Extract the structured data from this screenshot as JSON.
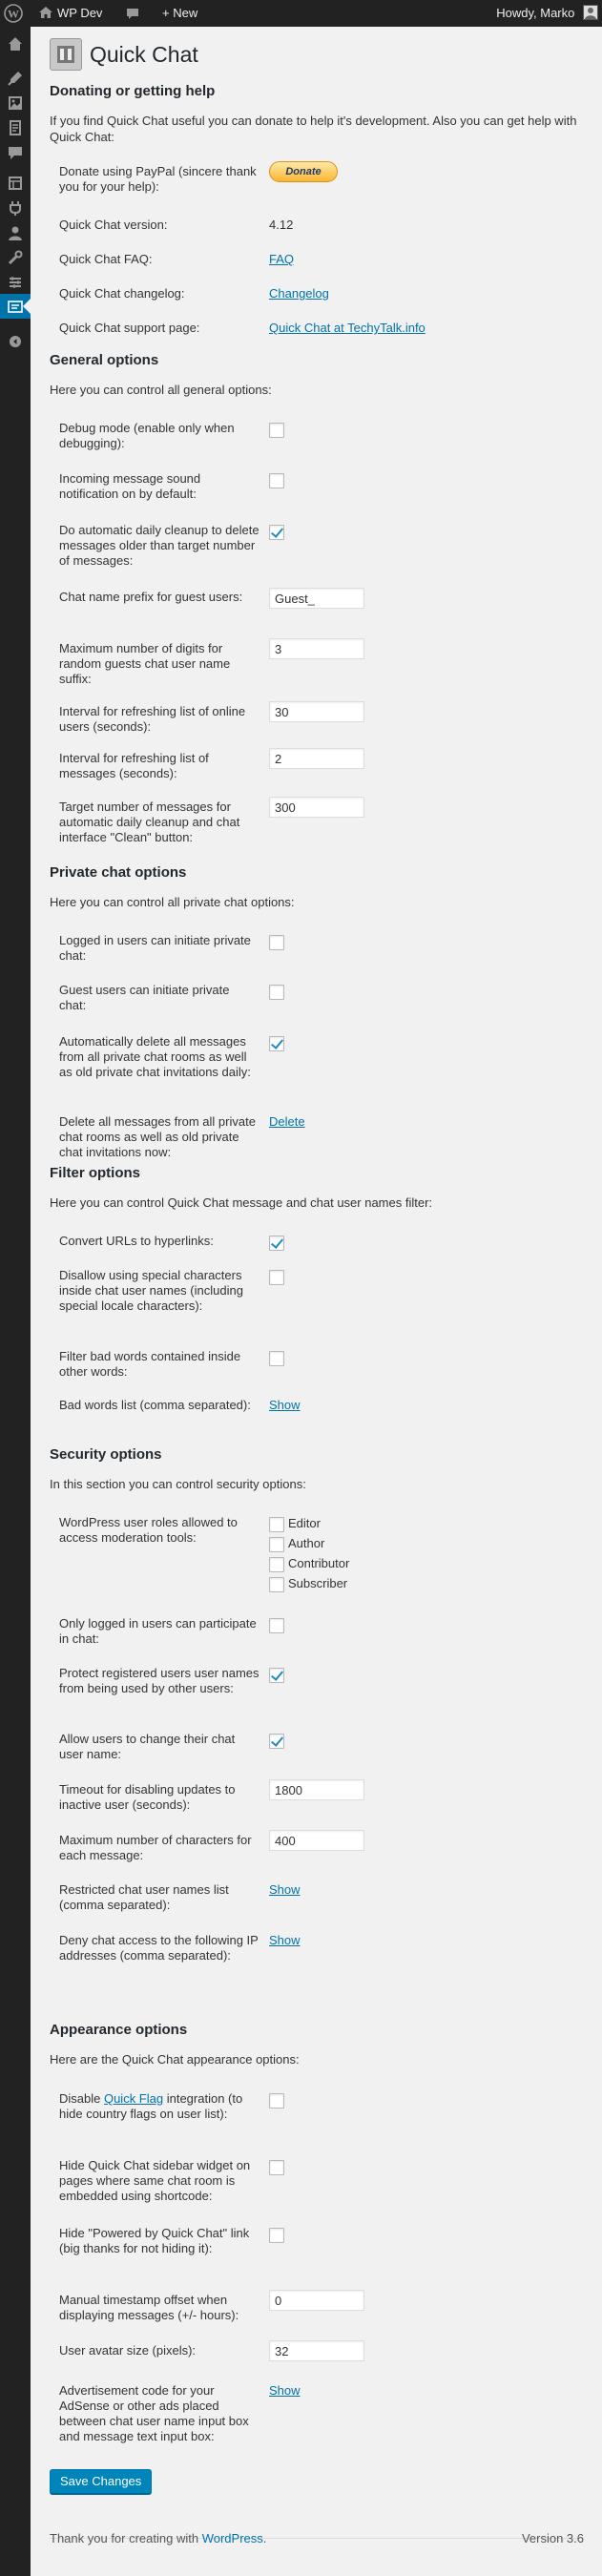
{
  "adminbar": {
    "site_name": "WP Dev",
    "new_label": "+ New",
    "howdy": "Howdy, Marko"
  },
  "page": {
    "title": "Quick Chat"
  },
  "donate": {
    "heading": "Donating or getting help",
    "desc": "If you find Quick Chat useful you can donate to help it's development. Also you can get help with Quick Chat:",
    "paypal_label": "Donate using PayPal (sincere thank you for your help):",
    "paypal_button": "Donate",
    "version_label": "Quick Chat version:",
    "version_value": "4.12",
    "faq_label": "Quick Chat FAQ:",
    "faq_link": "FAQ",
    "changelog_label": "Quick Chat changelog:",
    "changelog_link": "Changelog",
    "support_label": "Quick Chat support page:",
    "support_link": "Quick Chat at TechyTalk.info"
  },
  "general": {
    "heading": "General options",
    "desc": "Here you can control all general options:",
    "debug_label": "Debug mode (enable only when debugging):",
    "sound_label": "Incoming message sound notification on by default:",
    "cleanup_label": "Do automatic daily cleanup to delete messages older than target number of messages:",
    "prefix_label": "Chat name prefix for guest users:",
    "prefix_value": "Guest_",
    "digits_label": "Maximum number of digits for random guests chat user name suffix:",
    "digits_value": "3",
    "refresh_users_label": "Interval for refreshing list of online users (seconds):",
    "refresh_users_value": "30",
    "refresh_msgs_label": "Interval for refreshing list of messages (seconds):",
    "refresh_msgs_value": "2",
    "target_label": "Target number of messages for automatic daily cleanup and chat interface \"Clean\" button:",
    "target_value": "300"
  },
  "private": {
    "heading": "Private chat options",
    "desc": "Here you can control all private chat options:",
    "logged_label": "Logged in users can initiate private chat:",
    "guest_label": "Guest users can initiate private chat:",
    "autodelete_label": "Automatically delete all messages from all private chat rooms as well as old private chat invitations daily:",
    "deleteall_label": "Delete all messages from all private chat rooms as well as old private chat invitations now:",
    "delete_link": "Delete"
  },
  "filter": {
    "heading": "Filter options",
    "desc": "Here you can control Quick Chat message and chat user names filter:",
    "urls_label": "Convert URLs to hyperlinks:",
    "special_label": "Disallow using special characters inside chat user names (including special locale characters):",
    "inside_label": "Filter bad words contained inside other words:",
    "badwords_label": "Bad words list (comma separated):",
    "show": "Show"
  },
  "security": {
    "heading": "Security options",
    "desc": "In this section you can control security options:",
    "roles_label": "WordPress user roles allowed to access moderation tools:",
    "roles": [
      "Editor",
      "Author",
      "Contributor",
      "Subscriber"
    ],
    "only_logged_label": "Only logged in users can participate in chat:",
    "protect_label": "Protect registered users user names from being used by other users:",
    "allow_change_label": "Allow users to change their chat user name:",
    "timeout_label": "Timeout for disabling updates to inactive user (seconds):",
    "timeout_value": "1800",
    "maxchars_label": "Maximum number of characters for each message:",
    "maxchars_value": "400",
    "restricted_label": "Restricted chat user names list (comma separated):",
    "deny_label": "Deny chat access to the following IP addresses (comma separated):",
    "show": "Show"
  },
  "appearance": {
    "heading": "Appearance options",
    "desc": "Here are the Quick Chat appearance options:",
    "flag_pre": "Disable ",
    "flag_link": "Quick Flag",
    "flag_post": " integration (to hide country flags on user list):",
    "widget_label": "Hide Quick Chat sidebar widget on pages where same chat room is embedded using shortcode:",
    "powered_label": "Hide \"Powered by Quick Chat\" link (big thanks for not hiding it):",
    "offset_label": "Manual timestamp offset when displaying messages (+/- hours):",
    "offset_value": "0",
    "avatar_label": "User avatar size (pixels):",
    "avatar_value": "32",
    "adsense_label": "Advertisement code for your AdSense or other ads placed between chat user name input box and message text input box:",
    "show": "Show"
  },
  "save_button": "Save Changes",
  "footer": {
    "thanks_pre": "Thank you for creating with ",
    "thanks_link": "WordPress",
    "thanks_post": ".",
    "version": "Version 3.6"
  }
}
